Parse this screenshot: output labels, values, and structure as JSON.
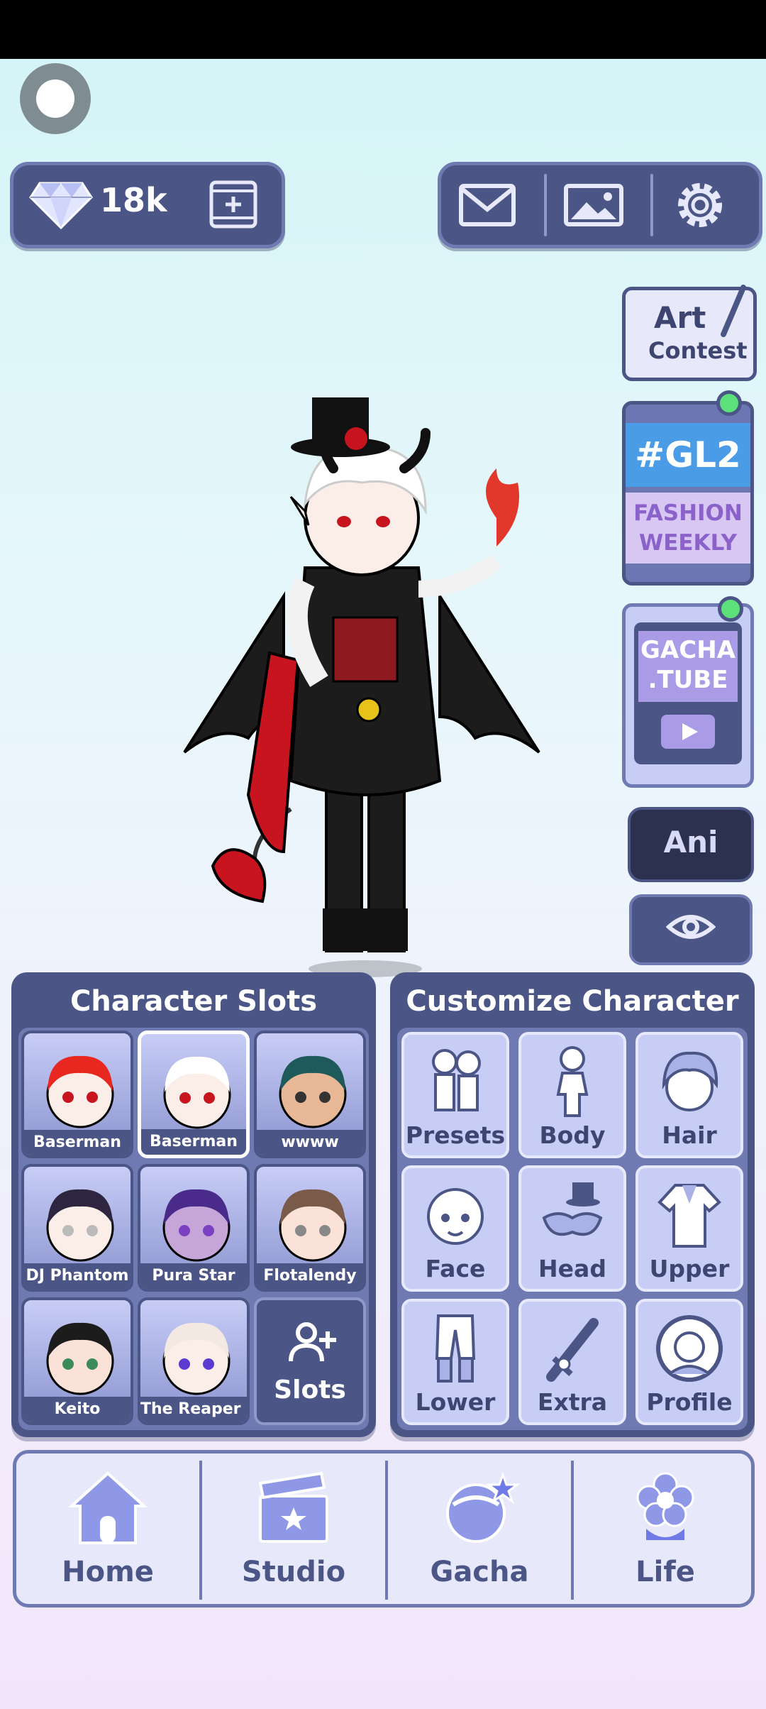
{
  "currency": {
    "gems_count": "18k"
  },
  "side_buttons": {
    "art_contest_line1": "Art",
    "art_contest_line2": "Contest",
    "fashion_tag": "#GL2",
    "fashion_line1": "FASHION",
    "fashion_line2": "WEEKLY",
    "gacha_tube_line1": "GACHA",
    "gacha_tube_line2": ".TUBE",
    "ani_label": "Ani"
  },
  "character_slots": {
    "title": "Character Slots",
    "slots": [
      {
        "name": "Baserman",
        "hair": "#e82820"
      },
      {
        "name": "Baserman",
        "hair": "#ffffff"
      },
      {
        "name": "wwww",
        "hair": "#1f5a5a"
      },
      {
        "name": "DJ Phantom",
        "hair": "#2e2640"
      },
      {
        "name": "Pura Star",
        "hair": "#4a2a8a"
      },
      {
        "name": "Flotalendy",
        "hair": "#7a5a48"
      },
      {
        "name": "Keito",
        "hair": "#1c1c1c"
      },
      {
        "name": "The Reaper Bo",
        "hair": "#f4e8e2"
      }
    ],
    "add_label": "Slots"
  },
  "customize": {
    "title": "Customize Character",
    "items": [
      "Presets",
      "Body",
      "Hair",
      "Face",
      "Head",
      "Upper",
      "Lower",
      "Extra",
      "Profile"
    ]
  },
  "nav": {
    "items": [
      "Home",
      "Studio",
      "Gacha",
      "Life"
    ]
  },
  "colors": {
    "panel": "#4b5686",
    "panel_light": "#6e7ab1",
    "tile": "#c8cdf6"
  }
}
